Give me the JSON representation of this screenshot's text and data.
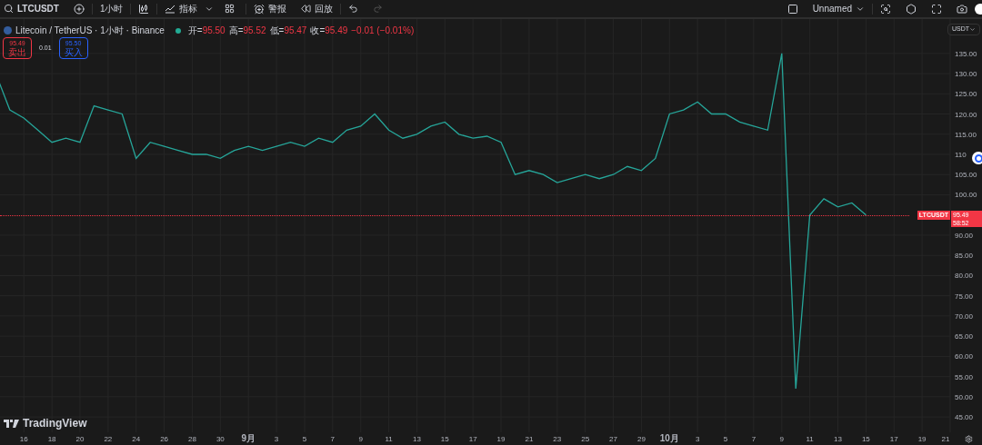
{
  "toolbar": {
    "symbol": "LTCUSDT",
    "interval": "1小时",
    "indicators_label": "指标",
    "alerts_label": "警报",
    "replay_label": "回放",
    "redo_disabled": true,
    "layout_name": "Unnamed"
  },
  "legend": {
    "title": "Litecoin / TetherUS · 1小时 · Binance",
    "ohlc": [
      {
        "label": "开=",
        "value": "95.50"
      },
      {
        "label": "高=",
        "value": "95.52"
      },
      {
        "label": "低=",
        "value": "95.47"
      },
      {
        "label": "收=",
        "value": "95.49"
      }
    ],
    "change": "−0.01 (−0.01%)"
  },
  "trade": {
    "sell_price": "95.49",
    "sell_label": "卖出",
    "spread": "0.01",
    "buy_price": "95.50",
    "buy_label": "买入"
  },
  "currency": "USDT",
  "price_tag": {
    "symbol": "LTCUSDT",
    "price": "95.49",
    "countdown": "58:52"
  },
  "logo": "TradingView",
  "chart_data": {
    "type": "line",
    "categories": [
      null,
      null,
      "16",
      null,
      "18",
      null,
      "20",
      null,
      "22",
      null,
      "24",
      null,
      "26",
      null,
      "28",
      null,
      "30",
      null,
      "9月",
      null,
      "3",
      null,
      "5",
      null,
      "7",
      null,
      "9",
      null,
      "11",
      null,
      "13",
      null,
      "15",
      null,
      "17",
      null,
      "19",
      null,
      "21",
      null,
      "23",
      null,
      "25",
      null,
      "27",
      null,
      "29",
      null,
      "10月",
      null,
      "3",
      null,
      "5",
      null,
      "7",
      null,
      "9",
      null,
      "11",
      null,
      "13",
      null,
      "15",
      null,
      "17",
      null,
      "19",
      null,
      "21"
    ],
    "series": [
      {
        "color": "#26a69a",
        "values": [
          130,
          121,
          119,
          116,
          113,
          114,
          113,
          122,
          121,
          120,
          109,
          113,
          112,
          111,
          110,
          110,
          109,
          111,
          112,
          111,
          112,
          113,
          112,
          114,
          113,
          116,
          117,
          120,
          116,
          114,
          115,
          117,
          118,
          115,
          114,
          114.5,
          113,
          105,
          106,
          105,
          103,
          104,
          105,
          104,
          105,
          107,
          106,
          109,
          120,
          121,
          123,
          120,
          120,
          118,
          117,
          116,
          135,
          52,
          95,
          99,
          97,
          98,
          95,
          null,
          null,
          null,
          null,
          null,
          null
        ]
      }
    ],
    "ylim": [
      41.2,
      143.5
    ],
    "grid": true,
    "yticks": [
      {
        "value": 135,
        "label": "135.00"
      },
      {
        "value": 130,
        "label": "130.00"
      },
      {
        "value": 125,
        "label": "125.00"
      },
      {
        "value": 120,
        "label": "120.00"
      },
      {
        "value": 115,
        "label": "115.00"
      },
      {
        "value": 110,
        "label": "110"
      },
      {
        "value": 105,
        "label": "105.00"
      },
      {
        "value": 100,
        "label": "100.00"
      },
      {
        "value": 90,
        "label": "90.00"
      },
      {
        "value": 85,
        "label": "85.00"
      },
      {
        "value": 80,
        "label": "80.00"
      },
      {
        "value": 75,
        "label": "75.00"
      },
      {
        "value": 70,
        "label": "70.00"
      },
      {
        "value": 65,
        "label": "65.00"
      },
      {
        "value": 60,
        "label": "60.00"
      },
      {
        "value": 55,
        "label": "55.00"
      },
      {
        "value": 50,
        "label": "50.00"
      },
      {
        "value": 45,
        "label": "45.00"
      }
    ]
  }
}
